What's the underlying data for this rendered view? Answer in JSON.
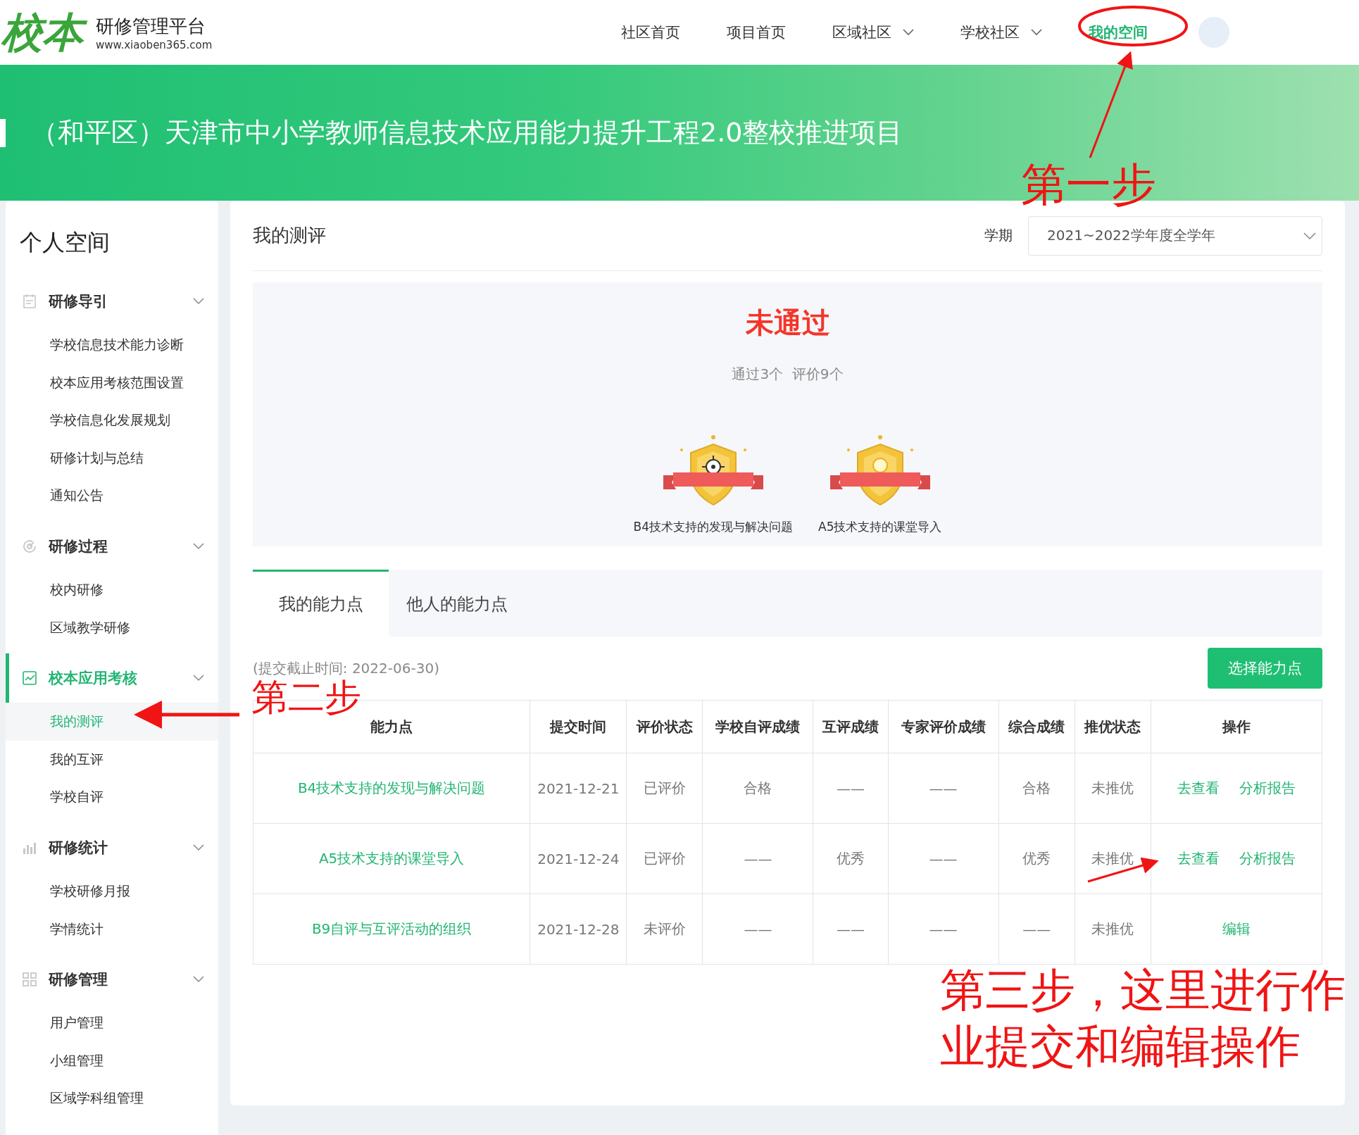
{
  "header": {
    "logo": {
      "mark": "校本",
      "name": "研修管理平台",
      "url": "www.xiaoben365.com"
    },
    "nav": [
      {
        "label": "社区首页",
        "dropdown": false,
        "selected": false
      },
      {
        "label": "项目首页",
        "dropdown": false,
        "selected": false
      },
      {
        "label": "区域社区",
        "dropdown": true,
        "selected": false
      },
      {
        "label": "学校社区",
        "dropdown": true,
        "selected": false
      },
      {
        "label": "我的空间",
        "dropdown": false,
        "selected": true
      }
    ]
  },
  "banner": {
    "title": "（和平区）天津市中小学教师信息技术应用能力提升工程2.0整校推进项目"
  },
  "sidebar": {
    "title": "个人空间",
    "groups": [
      {
        "label": "研修导引",
        "expanded": true,
        "selected": false,
        "items": [
          {
            "label": "学校信息技术能力诊断",
            "selected": false
          },
          {
            "label": "校本应用考核范围设置",
            "selected": false
          },
          {
            "label": "学校信息化发展规划",
            "selected": false
          },
          {
            "label": "研修计划与总结",
            "selected": false
          },
          {
            "label": "通知公告",
            "selected": false
          }
        ]
      },
      {
        "label": "研修过程",
        "expanded": true,
        "selected": false,
        "items": [
          {
            "label": "校内研修",
            "selected": false
          },
          {
            "label": "区域教学研修",
            "selected": false
          }
        ]
      },
      {
        "label": "校本应用考核",
        "expanded": true,
        "selected": true,
        "items": [
          {
            "label": "我的测评",
            "selected": true
          },
          {
            "label": "我的互评",
            "selected": false
          },
          {
            "label": "学校自评",
            "selected": false
          }
        ]
      },
      {
        "label": "研修统计",
        "expanded": true,
        "selected": false,
        "items": [
          {
            "label": "学校研修月报",
            "selected": false
          },
          {
            "label": "学情统计",
            "selected": false
          }
        ]
      },
      {
        "label": "研修管理",
        "expanded": true,
        "selected": false,
        "items": [
          {
            "label": "用户管理",
            "selected": false
          },
          {
            "label": "小组管理",
            "selected": false
          },
          {
            "label": "区域学科组管理",
            "selected": false
          }
        ]
      }
    ]
  },
  "main": {
    "title": "我的测评",
    "term": {
      "label": "学期",
      "value": "2021~2022学年度全学年"
    },
    "result": {
      "status": "未通过",
      "summary": "通过3个  评价9个",
      "badges": [
        {
          "label": "B4技术支持的发现与解决问题"
        },
        {
          "label": "A5技术支持的课堂导入"
        }
      ]
    },
    "tabs": [
      {
        "label": "我的能力点",
        "selected": true
      },
      {
        "label": "他人的能力点",
        "selected": false
      }
    ],
    "deadline": "(提交截止时间: 2022-06-30)",
    "select_button": "选择能力点",
    "table": {
      "columns": [
        "能力点",
        "提交时间",
        "评价状态",
        "学校自评成绩",
        "互评成绩",
        "专家评价成绩",
        "综合成绩",
        "推优状态",
        "操作"
      ],
      "rows": [
        {
          "cells": [
            "B4技术支持的发现与解决问题",
            "2021-12-21",
            "已评价",
            "合格",
            "——",
            "——",
            "合格",
            "未推优"
          ],
          "actions": [
            "去查看",
            "分析报告"
          ]
        },
        {
          "cells": [
            "A5技术支持的课堂导入",
            "2021-12-24",
            "已评价",
            "——",
            "优秀",
            "——",
            "优秀",
            "未推优"
          ],
          "actions": [
            "去查看",
            "分析报告"
          ]
        },
        {
          "cells": [
            "B9自评与互评活动的组织",
            "2021-12-28",
            "未评价",
            "——",
            "——",
            "——",
            "——",
            "未推优"
          ],
          "actions": [
            "编辑"
          ]
        }
      ]
    }
  },
  "annotations": [
    "第一步",
    "第二步",
    "第三步，这里进行作业提交和编辑操作"
  ]
}
